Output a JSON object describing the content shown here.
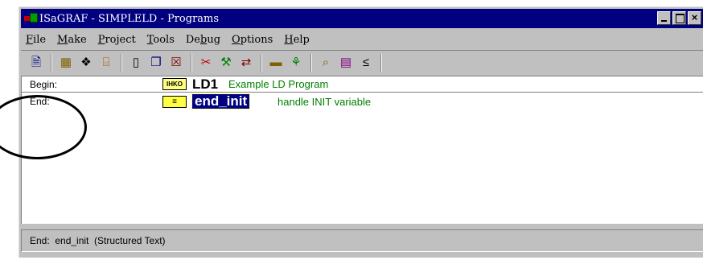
{
  "window": {
    "title": "ISaGRAF - SIMPLELD - Programs",
    "controls": {
      "minimize": "_",
      "maximize": "□",
      "close": "×"
    }
  },
  "menu": [
    {
      "pre": "",
      "u": "F",
      "post": "ile"
    },
    {
      "pre": "",
      "u": "M",
      "post": "ake"
    },
    {
      "pre": "",
      "u": "P",
      "post": "roject"
    },
    {
      "pre": "",
      "u": "T",
      "post": "ools"
    },
    {
      "pre": "De",
      "u": "b",
      "post": "ug"
    },
    {
      "pre": "",
      "u": "O",
      "post": "ptions"
    },
    {
      "pre": "",
      "u": "H",
      "post": "elp"
    }
  ],
  "toolbar": {
    "icons": [
      "document-icon",
      "dictionary-icon",
      "link-icon",
      "io-connection-icon",
      "new-program-icon",
      "copy-icon",
      "delete-icon",
      "cut-icon",
      "compile-icon",
      "import-icon",
      "memory-icon",
      "network-icon",
      "search-icon",
      "monitor-icon",
      "hierarchy-icon"
    ]
  },
  "programs": {
    "sections": [
      {
        "label": "Begin:"
      },
      {
        "label": "End:"
      }
    ],
    "items": [
      {
        "icon": "ladder-program-icon",
        "icon_text": "IHKO",
        "name": "LD1",
        "description": "Example LD Program",
        "selected": false
      },
      {
        "icon": "structured-text-program-icon",
        "icon_text": "≡",
        "name": "end_init",
        "description": "handle INIT variable",
        "selected": true
      }
    ]
  },
  "status": {
    "text": "End:  end_init  (Structured Text)"
  },
  "colors": {
    "title_bar": "#000080",
    "description": "#008000",
    "selection": "#000080"
  }
}
